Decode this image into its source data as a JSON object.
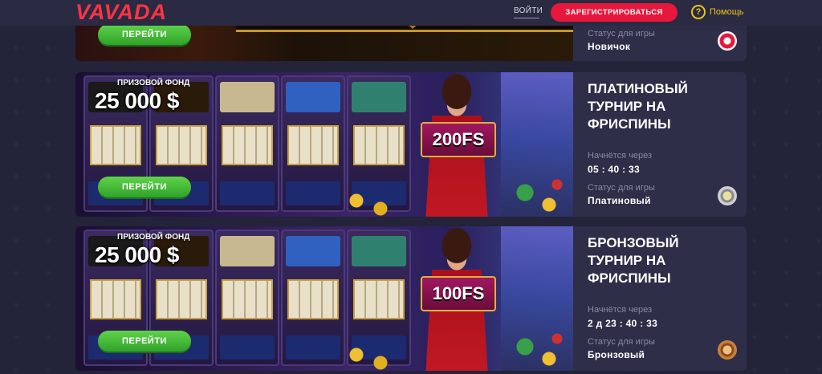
{
  "header": {
    "logo": "VAVADA",
    "login": "ВОЙТИ",
    "register": "ЗАРЕГИСТРИРОВАТЬСЯ",
    "help_icon": "?",
    "help": "Помощь"
  },
  "cards": [
    {
      "go": "ПЕРЕЙТИ",
      "status_label": "Статус для игры",
      "status_value": "Новичок",
      "status_color": "#e8173c"
    },
    {
      "prize_label": "ПРИЗОВОЙ ФОНД",
      "prize_amount": "25 000 $",
      "freespins": "200FS",
      "go": "ПЕРЕЙТИ",
      "title": "ПЛАТИНОВЫЙ ТУРНИР НА ФРИСПИНЫ",
      "starts_label": "Начнётся через",
      "starts_value": "05 : 40 : 33",
      "status_label": "Статус для игры",
      "status_value": "Платиновый",
      "status_color": "#b8b8c0"
    },
    {
      "prize_label": "ПРИЗОВОЙ ФОНД",
      "prize_amount": "25 000 $",
      "freespins": "100FS",
      "go": "ПЕРЕЙТИ",
      "title": "БРОНЗОВЫЙ ТУРНИР НА ФРИСПИНЫ",
      "starts_label": "Начнётся через",
      "starts_value": "2 д 23 : 40 : 33",
      "status_label": "Статус для игры",
      "status_value": "Бронзовый",
      "status_color": "#c8803a"
    }
  ]
}
